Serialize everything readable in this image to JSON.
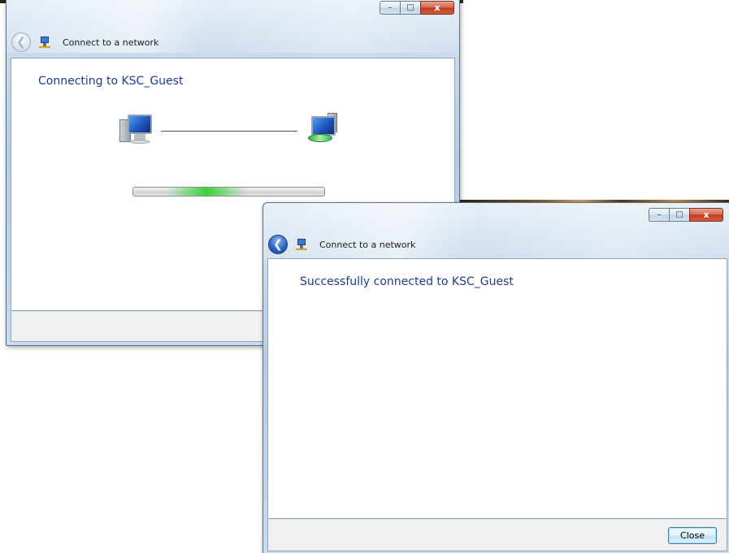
{
  "back_window": {
    "title": "Connect to a network",
    "heading": "Connecting to KSC_Guest",
    "caption_buttons": {
      "minimize": "–",
      "maximize": "□",
      "close": "x"
    },
    "icons": {
      "back": "back-arrow-icon",
      "network": "network-icon",
      "source": "computer-icon",
      "target": "network-computer-icon"
    },
    "progress": {
      "state": "indeterminate",
      "color": "#37d33a"
    }
  },
  "front_window": {
    "title": "Connect to a network",
    "heading": "Successfully connected to KSC_Guest",
    "caption_buttons": {
      "minimize": "–",
      "maximize": "□",
      "close": "x"
    },
    "icons": {
      "back": "back-arrow-icon",
      "network": "network-icon"
    },
    "close_button_label": "Close"
  },
  "colors": {
    "heading_text": "#1e3d8a",
    "close_button_red": "#c13d22",
    "footer_bg": "#f0f0f0"
  }
}
